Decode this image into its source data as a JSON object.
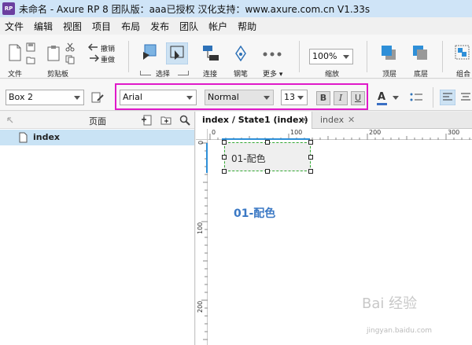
{
  "window": {
    "app_icon_text": "RP",
    "title": "未命名 - Axure RP 8 团队版：aaa已授权 汉化支持：www.axure.com.cn V1.33s"
  },
  "menu": [
    "文件",
    "编辑",
    "视图",
    "项目",
    "布局",
    "发布",
    "团队",
    "帐户",
    "帮助"
  ],
  "toolbar": {
    "file": "文件",
    "clipboard": "剪贴板",
    "undo": "撤销",
    "redo": "重做",
    "select": "选择",
    "connect": "连接",
    "pen": "钢笔",
    "more": "更多 ▾",
    "zoom_value": "100%",
    "zoom": "缩放",
    "top": "顶层",
    "bottom": "底层",
    "group": "组合"
  },
  "format": {
    "widget_name": "Box 2",
    "font_family": "Arial",
    "font_style": "Normal",
    "font_size": "13",
    "bold": "B",
    "italic": "I",
    "underline": "U",
    "font_color": "A"
  },
  "pages_panel": {
    "title": "页面",
    "items": [
      {
        "label": "index"
      }
    ]
  },
  "tabs": [
    {
      "label": "index / State1 (index)",
      "close": "✕"
    },
    {
      "label": "index",
      "close": "✕"
    }
  ],
  "ruler": {
    "h": [
      "0",
      "100",
      "200",
      "300"
    ],
    "v": [
      "0",
      "100",
      "200"
    ]
  },
  "canvas": {
    "box_text": "01-配色",
    "heading_text": "01-配色"
  },
  "watermark": {
    "text": "Bai 经验",
    "url": "jingyan.baidu.com"
  },
  "colors": {
    "highlight": "#e019c9",
    "heading": "#3a78c4",
    "title_bar": "#cfe4f7",
    "selected_page": "#c9e3f5"
  }
}
